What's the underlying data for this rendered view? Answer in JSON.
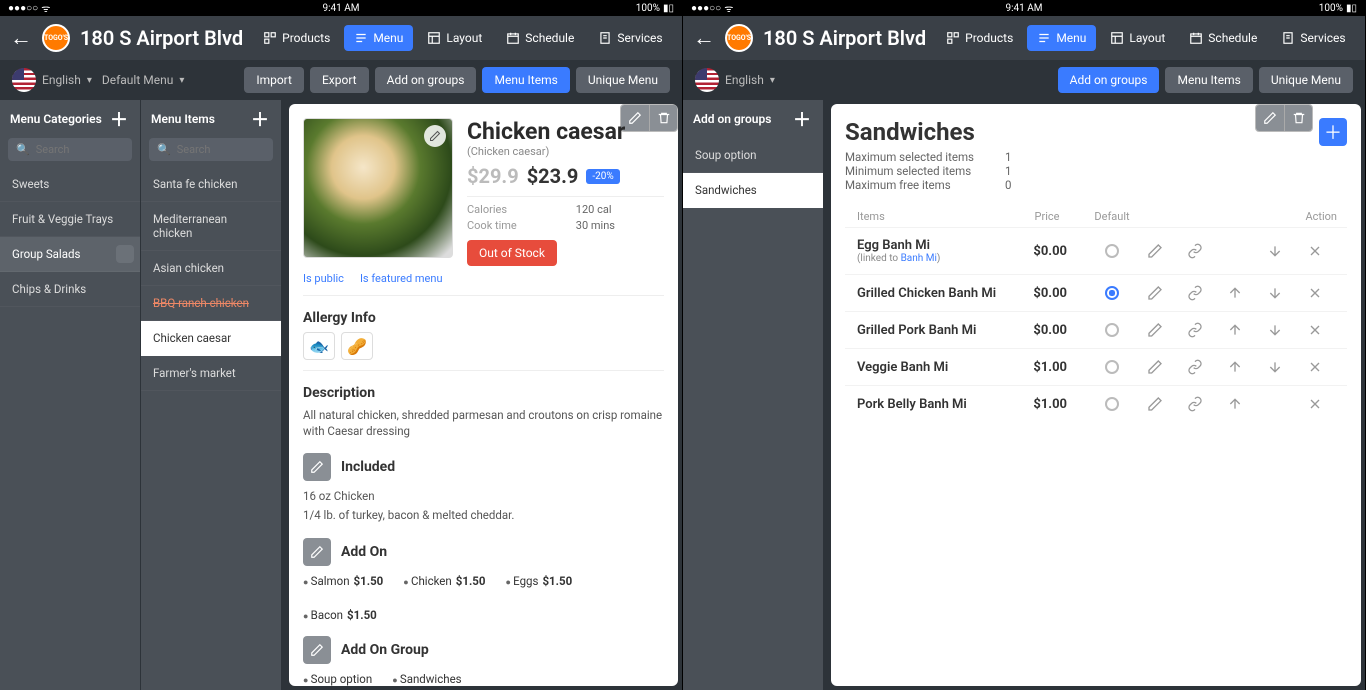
{
  "status": {
    "time": "9:41 AM",
    "battery": "100%",
    "carrier": "●●●○○",
    "wifi": "⏚"
  },
  "header": {
    "store": "180 S Airport Blvd",
    "nav": [
      {
        "icon": "products",
        "label": "Products"
      },
      {
        "icon": "menu",
        "label": "Menu",
        "active": true
      },
      {
        "icon": "layout",
        "label": "Layout"
      },
      {
        "icon": "schedule",
        "label": "Schedule"
      },
      {
        "icon": "services",
        "label": "Services"
      }
    ]
  },
  "langL": {
    "label": "English",
    "menuLabel": "Default Menu"
  },
  "langR": {
    "label": "English"
  },
  "pillsL": [
    "Import",
    "Export",
    "Add on groups",
    "Menu Items",
    "Unique Menu"
  ],
  "pillsLPrimaryIdx": 3,
  "pillsR": [
    "Add on groups",
    "Menu Items",
    "Unique Menu"
  ],
  "pillsRPrimaryIdx": 0,
  "cols": {
    "categories": {
      "title": "Menu Categories",
      "searchPh": "Search",
      "items": [
        {
          "t": "Sweets"
        },
        {
          "t": "Fruit & Veggie Trays"
        },
        {
          "t": "Group Salads",
          "sel": true,
          "gear": true
        },
        {
          "t": "Chips & Drinks"
        }
      ]
    },
    "menuItems": {
      "title": "Menu Items",
      "searchPh": "Search",
      "items": [
        {
          "t": "Santa fe chicken"
        },
        {
          "t": "Mediterranean chicken"
        },
        {
          "t": "Asian chicken"
        },
        {
          "t": "BBQ ranch chicken",
          "strike": true
        },
        {
          "t": "Chicken caesar",
          "sel": true
        },
        {
          "t": "Farmer's market"
        }
      ]
    },
    "addonGroups": {
      "title": "Add on groups",
      "items": [
        {
          "t": "Soup option"
        },
        {
          "t": "Sandwiches",
          "sel": true
        }
      ]
    }
  },
  "item": {
    "title": "Chicken caesar",
    "subtitle": "(Chicken caesar)",
    "oldPrice": "$29.9",
    "newPrice": "$23.9",
    "discount": "-20%",
    "caloriesLab": "Calories",
    "calories": "120 cal",
    "cookLab": "Cook time",
    "cook": "30 mins",
    "stockBtn": "Out of Stock",
    "isPublic": "Is public",
    "isFeatured": "Is featured menu",
    "allergyTitle": "Allergy Info",
    "allergyIcons": [
      "🐟",
      "🥜"
    ],
    "descTitle": "Description",
    "desc": "All natural chicken, shredded parmesan and croutons on crisp romaine with Caesar dressing",
    "includedTitle": "Included",
    "included": [
      "16 oz Chicken",
      "1/4 lb. of turkey, bacon & melted cheddar."
    ],
    "addonTitle": "Add On",
    "addons": [
      {
        "n": "Salmon",
        "p": "$1.50"
      },
      {
        "n": "Chicken",
        "p": "$1.50"
      },
      {
        "n": "Eggs",
        "p": "$1.50"
      },
      {
        "n": "Bacon",
        "p": "$1.50"
      }
    ],
    "addonGroupTitle": "Add On Group",
    "addonGroups": [
      "Soup option",
      "Sandwiches"
    ]
  },
  "group": {
    "title": "Sandwiches",
    "meta": [
      {
        "l": "Maximum selected items",
        "v": "1"
      },
      {
        "l": "Minimum selected items",
        "v": "1"
      },
      {
        "l": "Maximum free items",
        "v": "0"
      }
    ],
    "hdr": {
      "items": "Items",
      "price": "Price",
      "default": "Default",
      "action": "Action"
    },
    "rows": [
      {
        "n": "Egg Banh Mi",
        "link": "Banh Mi",
        "p": "$0.00",
        "def": false,
        "up": false,
        "down": true
      },
      {
        "n": "Grilled Chicken Banh Mi",
        "p": "$0.00",
        "def": true,
        "up": true,
        "down": true
      },
      {
        "n": "Grilled Pork Banh Mi",
        "p": "$0.00",
        "def": false,
        "up": true,
        "down": true
      },
      {
        "n": "Veggie Banh Mi",
        "p": "$1.00",
        "def": false,
        "up": true,
        "down": true
      },
      {
        "n": "Pork Belly Banh Mi",
        "p": "$1.00",
        "def": false,
        "up": true,
        "down": false
      }
    ]
  }
}
